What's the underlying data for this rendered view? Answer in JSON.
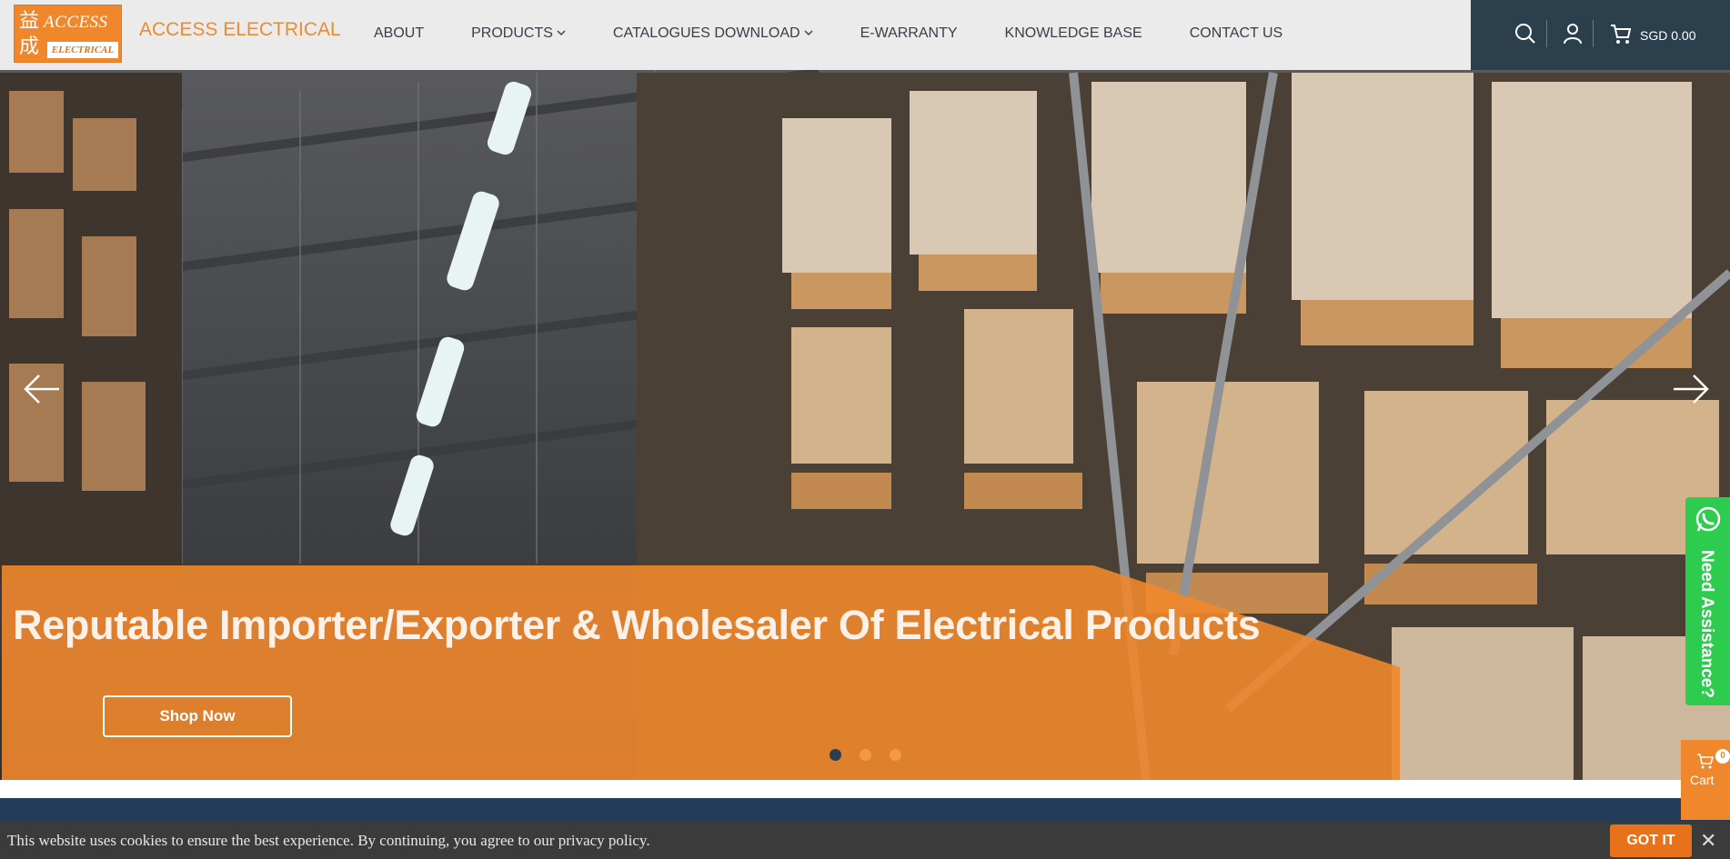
{
  "brand": {
    "logo_cn": "益成",
    "logo_top": "ACCESS",
    "logo_bottom": "ELECTRICAL",
    "name": "ACCESS ELECTRICAL"
  },
  "nav": {
    "items": [
      {
        "label": "ABOUT",
        "dropdown": false
      },
      {
        "label": "PRODUCTS",
        "dropdown": true
      },
      {
        "label": "CATALOGUES DOWNLOAD",
        "dropdown": true
      },
      {
        "label": "E-WARRANTY",
        "dropdown": false
      },
      {
        "label": "KNOWLEDGE BASE",
        "dropdown": false
      },
      {
        "label": "CONTACT US",
        "dropdown": false
      }
    ],
    "chevron": "⌄"
  },
  "utility": {
    "icons": [
      "search-icon",
      "user-icon",
      "cart-icon"
    ],
    "cart_total": "SGD 0.00"
  },
  "hero": {
    "title": "Reputable Importer/Exporter & Wholesaler Of Electrical Products",
    "cta": "Shop Now",
    "slides": 3,
    "active_slide": 1
  },
  "side": {
    "whatsapp_label": "Need Assistance?",
    "cart_label": "Cart",
    "cart_count": "0"
  },
  "cookie": {
    "text": "This website uses cookies to ensure the best experience. By continuing, you agree to our privacy policy.",
    "button": "GOT IT",
    "close": "✕"
  },
  "colors": {
    "accent": "#f0872c",
    "header_dark": "#2b3f4d",
    "whatsapp": "#2ecc4e",
    "cookie_bg": "#3b3b3b"
  }
}
